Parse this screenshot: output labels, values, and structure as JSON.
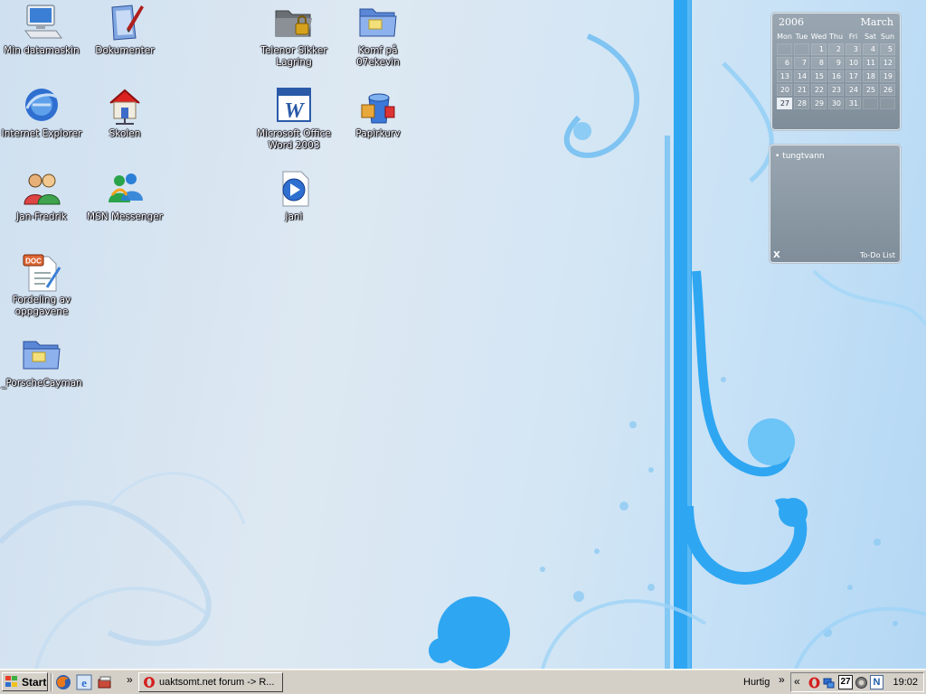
{
  "desktop": {
    "icons": [
      {
        "label": "Min datamaskin",
        "icon": "my-computer-icon"
      },
      {
        "label": "Dokumenter",
        "icon": "documents-icon"
      },
      {
        "label": "Telenor Sikker Lagring",
        "icon": "locked-folder-icon"
      },
      {
        "label": "Komf på 07ekevin",
        "icon": "folder-icon"
      },
      {
        "label": "Internet Explorer",
        "icon": "internet-explorer-icon"
      },
      {
        "label": "Skolen",
        "icon": "home-network-icon"
      },
      {
        "label": "Microsoft Office Word 2003",
        "icon": "word-icon"
      },
      {
        "label": "Papirkurv",
        "icon": "recycle-bin-icon"
      },
      {
        "label": "Jan-Fredrik",
        "icon": "users-icon"
      },
      {
        "label": "MSN Messenger",
        "icon": "msn-messenger-icon"
      },
      {
        "label": "jani",
        "icon": "media-file-icon"
      },
      {
        "label": "Fordeling av oppgavene",
        "icon": "doc-file-icon"
      },
      {
        "label": "_PorscheCayman",
        "icon": "folder-icon"
      }
    ]
  },
  "calendar": {
    "year": "2006",
    "month": "March",
    "weekdays": [
      "Mon",
      "Tue",
      "Wed",
      "Thu",
      "Fri",
      "Sat",
      "Sun"
    ],
    "days": [
      "",
      "",
      "1",
      "2",
      "3",
      "4",
      "5",
      "6",
      "7",
      "8",
      "9",
      "10",
      "11",
      "12",
      "13",
      "14",
      "15",
      "16",
      "17",
      "18",
      "19",
      "20",
      "21",
      "22",
      "23",
      "24",
      "25",
      "26",
      "27",
      "28",
      "29",
      "30",
      "31",
      "",
      ""
    ],
    "today": "27"
  },
  "todo": {
    "items": [
      "tungtvann"
    ],
    "close_label": "X",
    "title": "To-Do List"
  },
  "taskbar": {
    "start_label": "Start",
    "quick_launch_expand": "»",
    "task_label": "uaktsomt.net forum -> R...",
    "toolbar_label": "Hurtig",
    "toolbar_expand": "»",
    "tray_expand": "«",
    "tray_date_badge": "27",
    "tray_n_badge": "N",
    "clock": "19:02"
  },
  "colors": {
    "wallpaper_accent": "#2ea6f2",
    "taskbar": "#d4d0c8"
  }
}
